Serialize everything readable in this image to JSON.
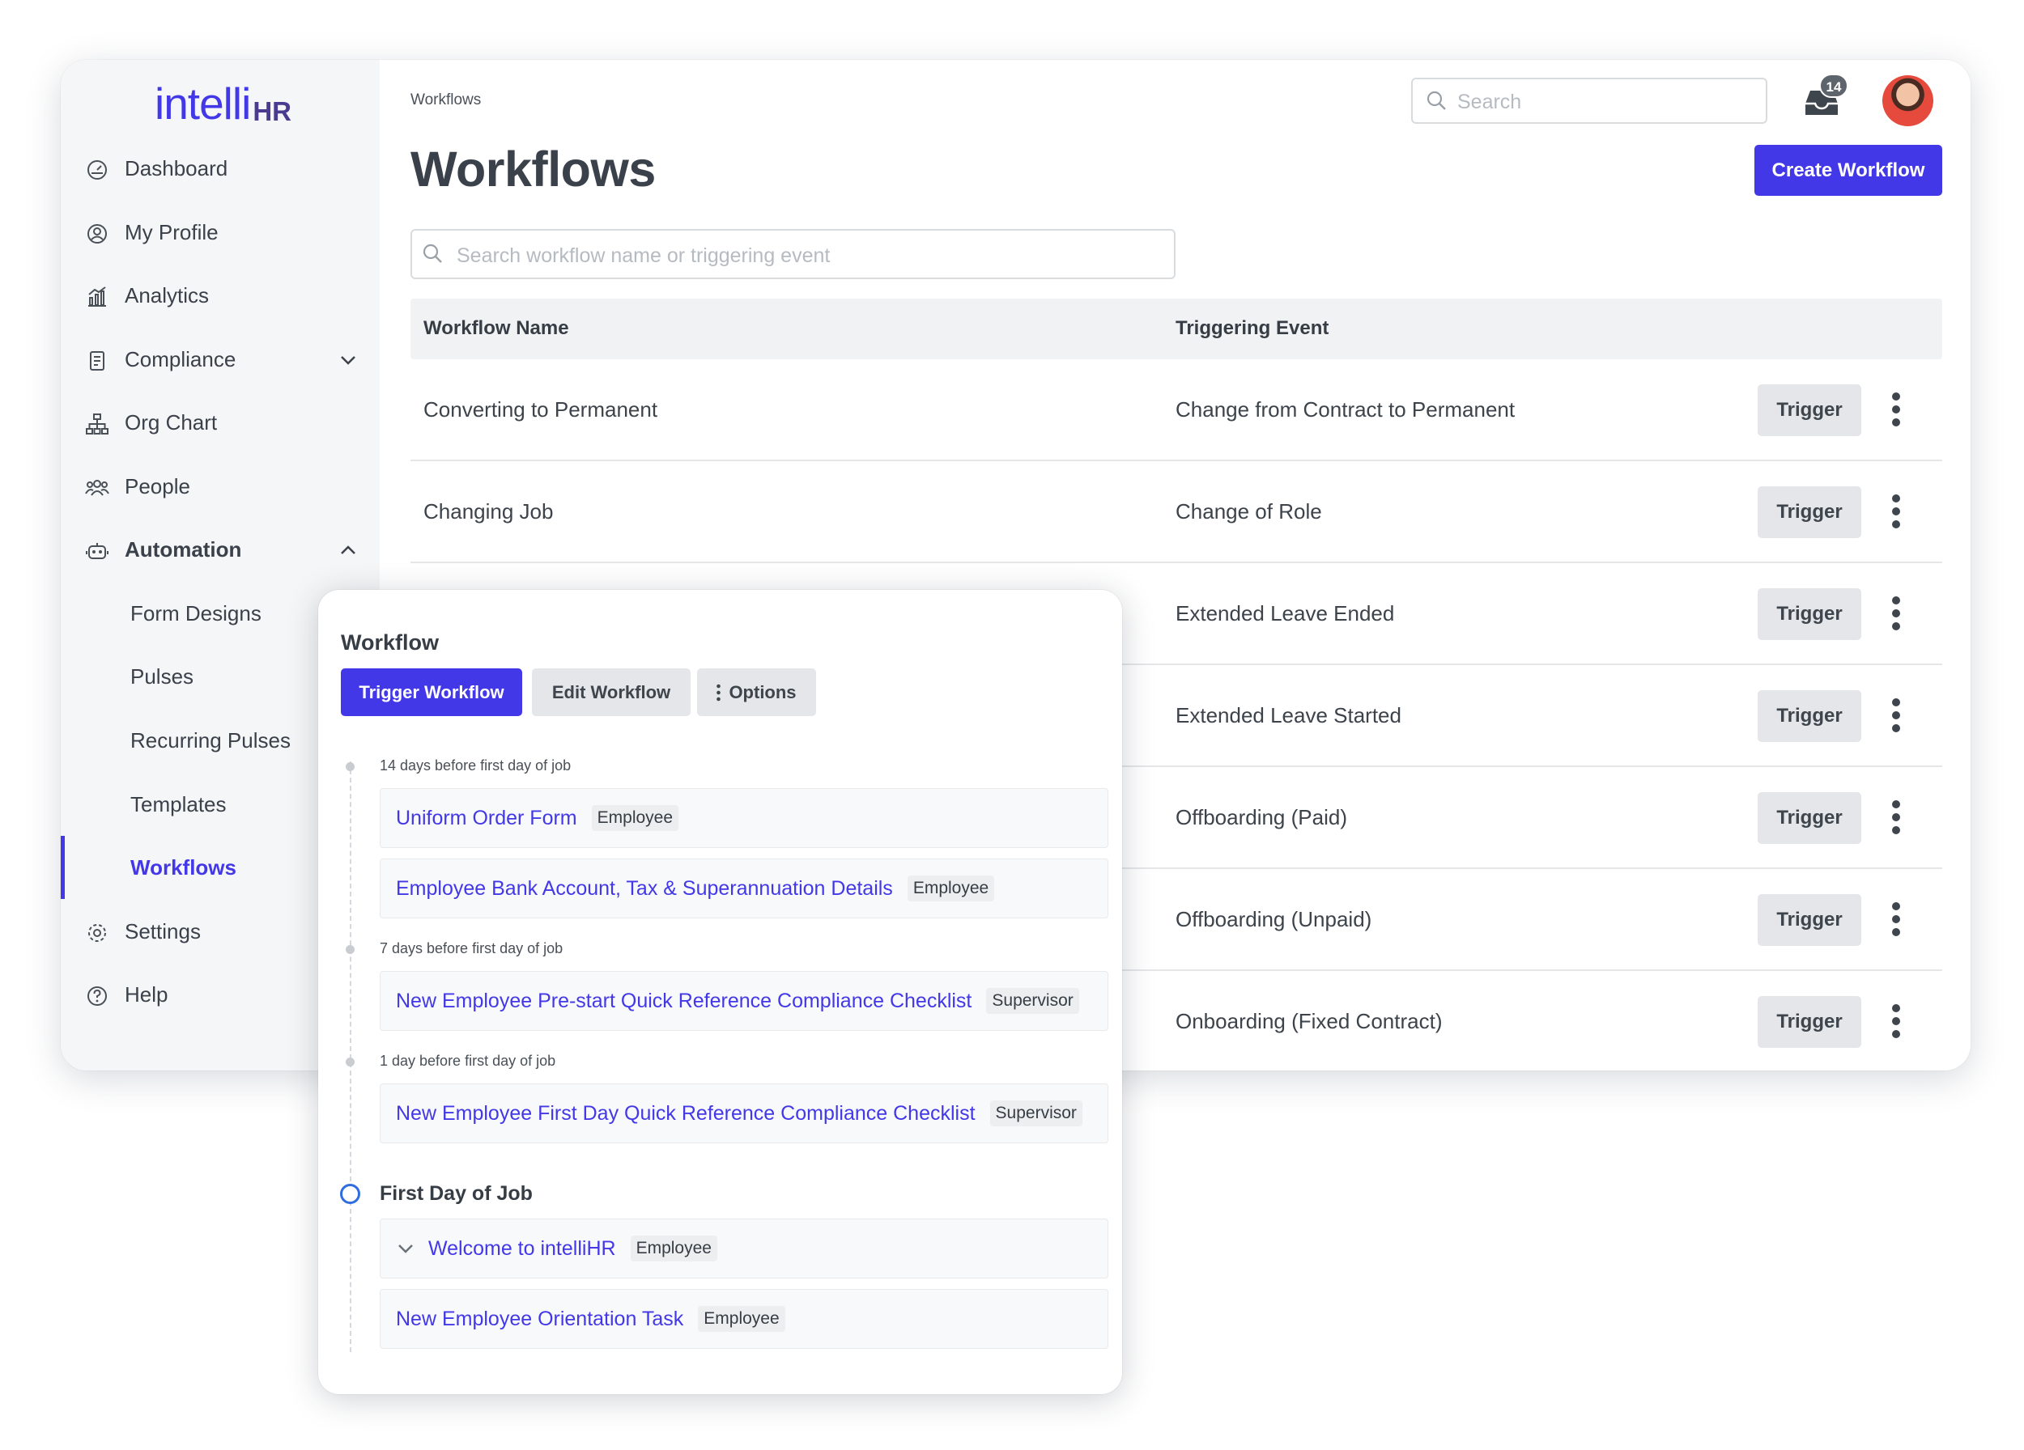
{
  "logo": {
    "part1": "intelli",
    "part2": "HR"
  },
  "sidebar": {
    "items": [
      {
        "label": "Dashboard",
        "icon": "dashboard-icon"
      },
      {
        "label": "My Profile",
        "icon": "profile-icon"
      },
      {
        "label": "Analytics",
        "icon": "analytics-icon"
      },
      {
        "label": "Compliance",
        "icon": "compliance-icon"
      },
      {
        "label": "Org Chart",
        "icon": "org-chart-icon"
      },
      {
        "label": "People",
        "icon": "people-icon"
      },
      {
        "label": "Automation",
        "icon": "robot-icon"
      },
      {
        "label": "Settings",
        "icon": "gear-icon"
      },
      {
        "label": "Help",
        "icon": "help-icon"
      }
    ],
    "automation_sub": [
      {
        "label": "Form Designs"
      },
      {
        "label": "Pulses"
      },
      {
        "label": "Recurring Pulses"
      },
      {
        "label": "Templates"
      },
      {
        "label": "Workflows"
      }
    ],
    "active": "Workflows"
  },
  "header": {
    "breadcrumb": "Workflows",
    "title": "Workflows",
    "search_placeholder": "Search",
    "notification_count": "14",
    "create_button": "Create Workflow"
  },
  "workflows": {
    "search_placeholder": "Search workflow name or triggering event",
    "columns": [
      "Workflow Name",
      "Triggering Event"
    ],
    "trigger_label": "Trigger",
    "rows": [
      {
        "name": "Converting to Permanent",
        "event": "Change from Contract to Permanent"
      },
      {
        "name": "Changing Job",
        "event": "Change of Role"
      },
      {
        "name": "",
        "event": "Extended Leave Ended"
      },
      {
        "name": "",
        "event": "Extended Leave Started"
      },
      {
        "name": "",
        "event": "Offboarding (Paid)"
      },
      {
        "name": "",
        "event": "Offboarding (Unpaid)"
      },
      {
        "name": "",
        "event": "Onboarding (Fixed Contract)"
      }
    ]
  },
  "workflow_card": {
    "title": "Workflow",
    "buttons": {
      "trigger": "Trigger Workflow",
      "edit": "Edit Workflow",
      "options": "Options"
    },
    "groups": [
      {
        "label": "14 days before first day of job",
        "tasks": [
          {
            "name": "Uniform Order Form",
            "role": "Employee"
          },
          {
            "name": "Employee Bank Account, Tax & Superannuation Details",
            "role": "Employee"
          }
        ]
      },
      {
        "label": "7 days before first day of job",
        "tasks": [
          {
            "name": "New Employee Pre-start Quick Reference Compliance Checklist",
            "role": "Supervisor"
          }
        ]
      },
      {
        "label": "1 day before first day of job",
        "tasks": [
          {
            "name": "New Employee First Day Quick Reference Compliance Checklist",
            "role": "Supervisor"
          }
        ]
      },
      {
        "label": "First Day of Job",
        "tasks": [
          {
            "name": "Welcome to intelliHR",
            "role": "Employee"
          },
          {
            "name": "New Employee Orientation Task",
            "role": "Employee"
          }
        ]
      }
    ]
  },
  "colors": {
    "accent": "#4338e8",
    "timeline_current": "#2f6de0"
  }
}
